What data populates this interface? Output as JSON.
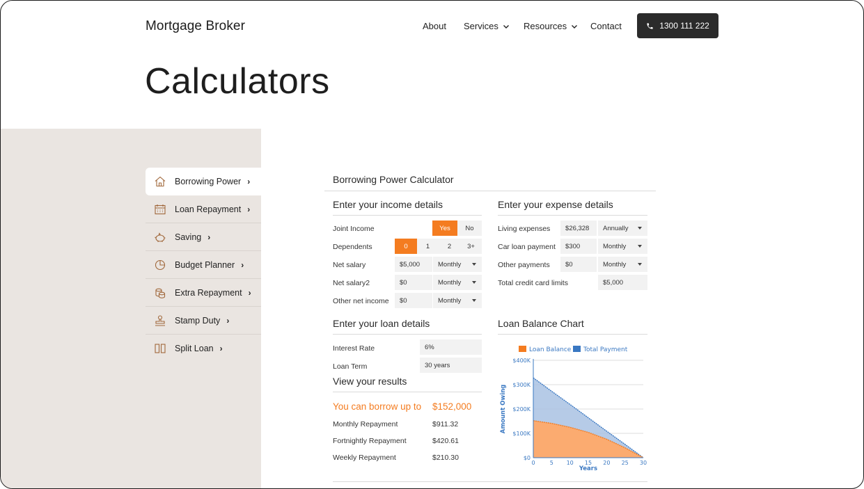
{
  "header": {
    "brand": "Mortgage Broker",
    "nav": [
      {
        "label": "About",
        "dropdown": false
      },
      {
        "label": "Services",
        "dropdown": true
      },
      {
        "label": "Resources",
        "dropdown": true
      },
      {
        "label": "Contact",
        "dropdown": false
      }
    ],
    "phone_label": "1300 111 222"
  },
  "page": {
    "title": "Calculators"
  },
  "sidebar": {
    "items": [
      {
        "label": "Borrowing Power",
        "icon": "house-icon",
        "active": true
      },
      {
        "label": "Loan Repayment",
        "icon": "calendar-icon",
        "active": false
      },
      {
        "label": "Saving",
        "icon": "piggy-bank-icon",
        "active": false
      },
      {
        "label": "Budget Planner",
        "icon": "pie-chart-icon",
        "active": false
      },
      {
        "label": "Extra Repayment",
        "icon": "coins-icon",
        "active": false
      },
      {
        "label": "Stamp Duty",
        "icon": "stamp-icon",
        "active": false
      },
      {
        "label": "Split Loan",
        "icon": "split-icon",
        "active": false
      }
    ]
  },
  "calculator": {
    "title": "Borrowing Power Calculator",
    "income": {
      "title": "Enter your income details",
      "joint_income_label": "Joint Income",
      "joint_options": [
        "Yes",
        "No"
      ],
      "joint_selected": "Yes",
      "dependents_label": "Dependents",
      "dependents_options": [
        "0",
        "1",
        "2",
        "3+"
      ],
      "dependents_selected": "0",
      "net_salary_label": "Net salary",
      "net_salary_value": "$5,000",
      "net_salary_freq": "Monthly",
      "net_salary2_label": "Net salary2",
      "net_salary2_value": "$0",
      "net_salary2_freq": "Monthly",
      "other_income_label": "Other net income",
      "other_income_value": "$0",
      "other_income_freq": "Monthly"
    },
    "expense": {
      "title": "Enter your expense details",
      "living_label": "Living expenses",
      "living_value": "$26,328",
      "living_freq": "Annually",
      "car_label": "Car loan payment",
      "car_value": "$300",
      "car_freq": "Monthly",
      "other_label": "Other payments",
      "other_value": "$0",
      "other_freq": "Monthly",
      "credit_label": "Total credit card limits",
      "credit_value": "$5,000"
    },
    "loan": {
      "title": "Enter your loan details",
      "rate_label": "Interest Rate",
      "rate_value": "6%",
      "term_label": "Loan Term",
      "term_value": "30 years"
    },
    "results": {
      "title": "View your results",
      "borrow_label": "You can borrow up to",
      "borrow_value": "$152,000",
      "monthly_label": "Monthly Repayment",
      "monthly_value": "$911.32",
      "fortnightly_label": "Fortnightly Repayment",
      "fortnightly_value": "$420.61",
      "weekly_label": "Weekly Repayment",
      "weekly_value": "$210.30"
    },
    "chart_title": "Loan Balance Chart"
  },
  "colors": {
    "accent": "#f47c20",
    "series_blue": "#3a78c2",
    "sidebar_bg": "#eae5e1"
  },
  "chart_data": {
    "type": "area",
    "title": "",
    "xlabel": "Years",
    "ylabel": "Amount Owing",
    "x": [
      0,
      5,
      10,
      15,
      20,
      25,
      30
    ],
    "x_ticks": [
      "0",
      "5",
      "10",
      "15",
      "20",
      "25",
      "30"
    ],
    "y_ticks": [
      "$0",
      "$100K",
      "$200K",
      "$300K",
      "$400K"
    ],
    "xlim": [
      0,
      30
    ],
    "ylim": [
      0,
      400000
    ],
    "legend_position": "top",
    "series": [
      {
        "name": "Loan Balance",
        "color": "#f47c20",
        "values": [
          152000,
          141000,
          125000,
          104000,
          76000,
          41000,
          0
        ]
      },
      {
        "name": "Total Payment",
        "color": "#3a78c2",
        "values": [
          328000,
          273000,
          219000,
          164000,
          109000,
          55000,
          0
        ]
      }
    ]
  }
}
